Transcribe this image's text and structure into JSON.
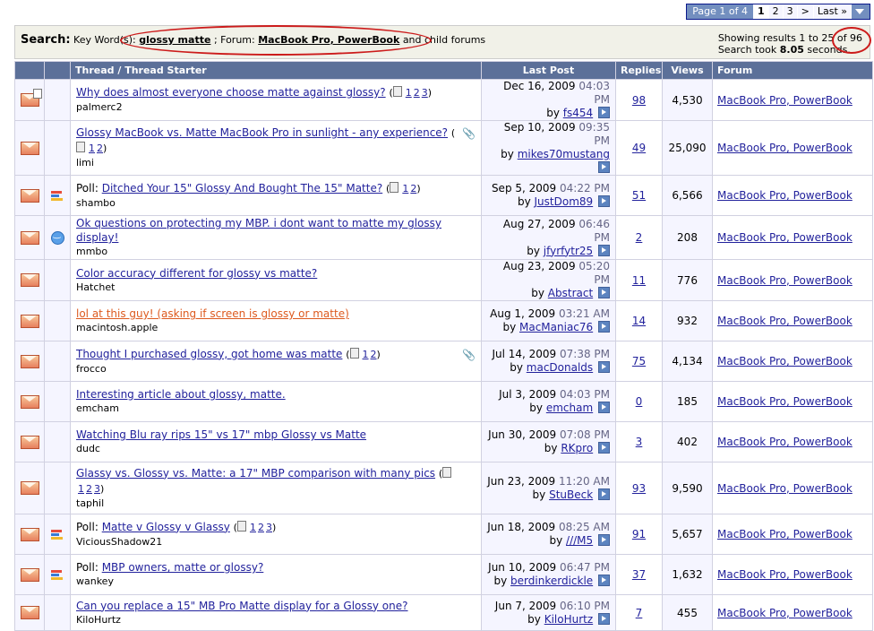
{
  "pagination": {
    "label": "Page 1 of 4",
    "current": "1",
    "pages": [
      "2",
      "3"
    ],
    "next": ">",
    "last": "Last »"
  },
  "search": {
    "title": "Search:",
    "keyword_label": "Key Word(s):",
    "keywords": "glossy matte",
    "forum_label": "; Forum:",
    "forum": "MacBook Pro, PowerBook",
    "forum_suffix": "and child forums",
    "results_prefix": "Showing results 1 to 25",
    "results_total": "of 96",
    "took_prefix": "Search took",
    "took_value": "8.05",
    "took_suffix": "seconds."
  },
  "table": {
    "headers": [
      "Thread / Thread Starter",
      "Last Post",
      "Replies",
      "Views",
      "Forum"
    ]
  },
  "threads": [
    {
      "prefix": "",
      "title": "Why does almost everyone choose matte against glossy?",
      "pages": [
        "1",
        "2",
        "3"
      ],
      "starter": "palmerc2",
      "date": "Dec 16, 2009",
      "time": "04:03 PM",
      "by": "fs454",
      "replies": "98",
      "views": "4,530",
      "forum": "MacBook Pro, PowerBook",
      "icon2": "",
      "status": "dot",
      "clip": false,
      "hot": false
    },
    {
      "prefix": "",
      "title": "Glossy MacBook vs. Matte MacBook Pro in sunlight - any experience?",
      "pages": [
        "1",
        "2"
      ],
      "starter": "limi",
      "date": "Sep 10, 2009",
      "time": "09:35 PM",
      "by": "mikes70mustang",
      "replies": "49",
      "views": "25,090",
      "forum": "MacBook Pro, PowerBook",
      "icon2": "",
      "status": "",
      "clip": true,
      "hot": false
    },
    {
      "prefix": "Poll:",
      "title": "Ditched Your 15\" Glossy And Bought The 15\" Matte?",
      "pages": [
        "1",
        "2"
      ],
      "starter": "shambo",
      "date": "Sep 5, 2009",
      "time": "04:22 PM",
      "by": "JustDom89",
      "replies": "51",
      "views": "6,566",
      "forum": "MacBook Pro, PowerBook",
      "icon2": "poll",
      "status": "",
      "clip": false,
      "hot": false
    },
    {
      "prefix": "",
      "title": "Ok questions on protecting my MBP. i dont want to matte my glossy display!",
      "pages": [],
      "starter": "mmbo",
      "date": "Aug 27, 2009",
      "time": "06:46 PM",
      "by": "jfyrfytr25",
      "replies": "2",
      "views": "208",
      "forum": "MacBook Pro, PowerBook",
      "icon2": "smiley",
      "status": "",
      "clip": false,
      "hot": false
    },
    {
      "prefix": "",
      "title": "Color accuracy different for glossy vs matte?",
      "pages": [],
      "starter": "Hatchet",
      "date": "Aug 23, 2009",
      "time": "05:20 PM",
      "by": "Abstract",
      "replies": "11",
      "views": "776",
      "forum": "MacBook Pro, PowerBook",
      "icon2": "",
      "status": "",
      "clip": false,
      "hot": false
    },
    {
      "prefix": "",
      "title": "lol at this guy! (asking if screen is glossy or matte)",
      "pages": [],
      "starter": "macintosh.apple",
      "date": "Aug 1, 2009",
      "time": "03:21 AM",
      "by": "MacManiac76",
      "replies": "14",
      "views": "932",
      "forum": "MacBook Pro, PowerBook",
      "icon2": "",
      "status": "",
      "clip": false,
      "hot": true
    },
    {
      "prefix": "",
      "title": "Thought I purchased glossy, got home was matte",
      "pages": [
        "1",
        "2"
      ],
      "starter": "frocco",
      "date": "Jul 14, 2009",
      "time": "07:38 PM",
      "by": "macDonalds",
      "replies": "75",
      "views": "4,134",
      "forum": "MacBook Pro, PowerBook",
      "icon2": "",
      "status": "",
      "clip": true,
      "hot": false
    },
    {
      "prefix": "",
      "title": "Interesting article about glossy, matte.",
      "pages": [],
      "starter": "emcham",
      "date": "Jul 3, 2009",
      "time": "04:03 PM",
      "by": "emcham",
      "replies": "0",
      "views": "185",
      "forum": "MacBook Pro, PowerBook",
      "icon2": "",
      "status": "",
      "clip": false,
      "hot": false
    },
    {
      "prefix": "",
      "title": "Watching Blu ray rips 15\" vs 17\" mbp Glossy vs Matte",
      "pages": [],
      "starter": "dudc",
      "date": "Jun 30, 2009",
      "time": "07:08 PM",
      "by": "RKpro",
      "replies": "3",
      "views": "402",
      "forum": "MacBook Pro, PowerBook",
      "icon2": "",
      "status": "",
      "clip": false,
      "hot": false
    },
    {
      "prefix": "",
      "title": "Glassy vs. Glossy vs. Matte: a 17\" MBP comparison with many pics",
      "pages": [
        "1",
        "2",
        "3"
      ],
      "starter": "taphil",
      "date": "Jun 23, 2009",
      "time": "11:20 AM",
      "by": "StuBeck",
      "replies": "93",
      "views": "9,590",
      "forum": "MacBook Pro, PowerBook",
      "icon2": "",
      "status": "",
      "clip": false,
      "hot": false
    },
    {
      "prefix": "Poll:",
      "title": "Matte v Glossy v Glassy",
      "pages": [
        "1",
        "2",
        "3"
      ],
      "starter": "ViciousShadow21",
      "date": "Jun 18, 2009",
      "time": "08:25 AM",
      "by": "///M5",
      "replies": "91",
      "views": "5,657",
      "forum": "MacBook Pro, PowerBook",
      "icon2": "poll",
      "status": "",
      "clip": false,
      "hot": false
    },
    {
      "prefix": "Poll:",
      "title": "MBP owners, matte or glossy?",
      "pages": [],
      "starter": "wankey",
      "date": "Jun 10, 2009",
      "time": "06:47 PM",
      "by": "berdinkerdickle",
      "replies": "37",
      "views": "1,632",
      "forum": "MacBook Pro, PowerBook",
      "icon2": "poll",
      "status": "",
      "clip": false,
      "hot": false
    },
    {
      "prefix": "",
      "title": "Can you replace a 15\" MB Pro Matte display for a Glossy one?",
      "pages": [],
      "starter": "KiloHurtz",
      "date": "Jun 7, 2009",
      "time": "06:10 PM",
      "by": "KiloHurtz",
      "replies": "7",
      "views": "455",
      "forum": "MacBook Pro, PowerBook",
      "icon2": "",
      "status": "",
      "clip": false,
      "hot": false
    }
  ]
}
